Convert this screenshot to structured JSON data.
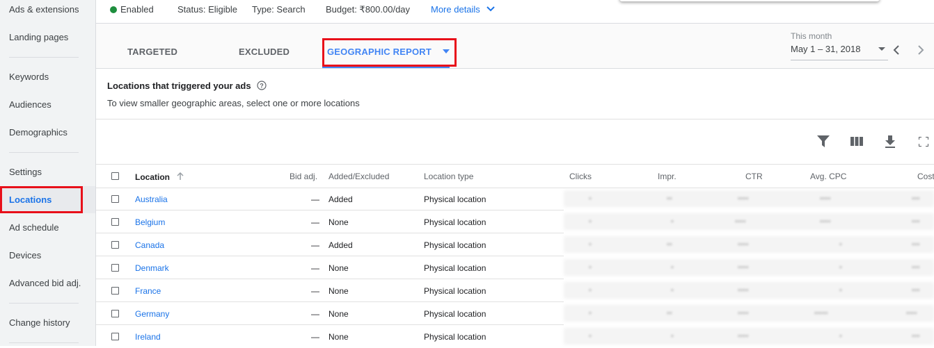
{
  "sidebar": {
    "items": [
      {
        "label": "Ads & extensions"
      },
      {
        "label": "Landing pages"
      },
      {
        "label": "Keywords"
      },
      {
        "label": "Audiences"
      },
      {
        "label": "Demographics"
      },
      {
        "label": "Settings"
      },
      {
        "label": "Locations"
      },
      {
        "label": "Ad schedule"
      },
      {
        "label": "Devices"
      },
      {
        "label": "Advanced bid adj."
      },
      {
        "label": "Change history"
      }
    ],
    "active": "Locations"
  },
  "campaign_status": {
    "enabled": "Enabled",
    "status": "Status: Eligible",
    "type": "Type: Search",
    "budget": "Budget: ₹800.00/day",
    "more_details": "More details"
  },
  "tabs": [
    {
      "label": "TARGETED"
    },
    {
      "label": "EXCLUDED"
    },
    {
      "label": "GEOGRAPHIC REPORT"
    }
  ],
  "date_range": {
    "label": "This month",
    "value": "May 1 – 31, 2018"
  },
  "section": {
    "title": "Locations that triggered your ads",
    "subtitle": "To view smaller geographic areas, select one or more locations"
  },
  "table": {
    "columns": [
      "Location",
      "Bid adj.",
      "Added/Excluded",
      "Location type",
      "Clicks",
      "Impr.",
      "CTR",
      "Avg. CPC",
      "Cost"
    ],
    "rows": [
      {
        "location": "Australia",
        "bid_adj": "—",
        "added": "Added",
        "type": "Physical location"
      },
      {
        "location": "Belgium",
        "bid_adj": "—",
        "added": "None",
        "type": "Physical location"
      },
      {
        "location": "Canada",
        "bid_adj": "—",
        "added": "Added",
        "type": "Physical location"
      },
      {
        "location": "Denmark",
        "bid_adj": "—",
        "added": "None",
        "type": "Physical location"
      },
      {
        "location": "France",
        "bid_adj": "—",
        "added": "None",
        "type": "Physical location"
      },
      {
        "location": "Germany",
        "bid_adj": "—",
        "added": "None",
        "type": "Physical location"
      },
      {
        "location": "Ireland",
        "bid_adj": "—",
        "added": "None",
        "type": "Physical location"
      }
    ]
  },
  "colors": {
    "accent": "#4285f4",
    "link": "#1a73e8",
    "highlight": "#e8101a",
    "enabled": "#1e8e3e"
  },
  "icons": [
    "help-icon",
    "filter-icon",
    "columns-icon",
    "download-icon",
    "fullscreen-icon",
    "chevron-down-icon",
    "chevron-left-icon",
    "chevron-right-icon",
    "sort-up-icon"
  ]
}
